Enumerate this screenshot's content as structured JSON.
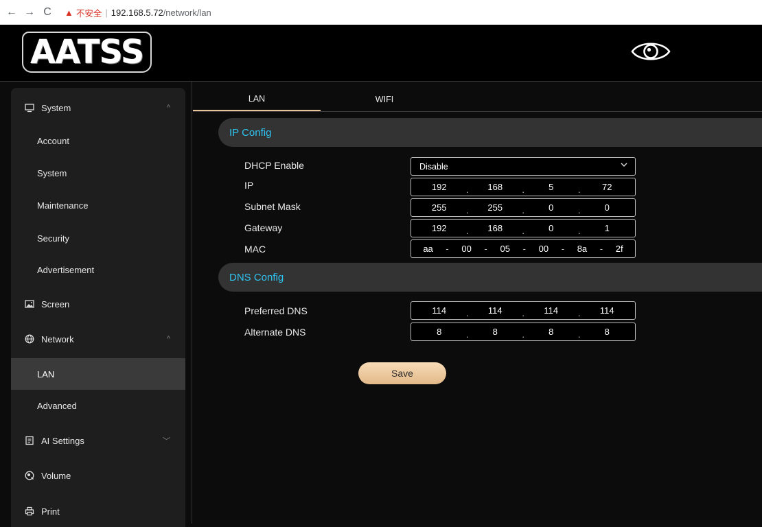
{
  "browser": {
    "back": "←",
    "forward": "→",
    "reload": "C",
    "warn": "▲",
    "insecure": "不安全",
    "sep": "|",
    "host": "192.168.5.72",
    "path": "/network/lan"
  },
  "header": {
    "logo": "AATSS"
  },
  "sidebar": {
    "system": {
      "label": "System",
      "chevron": "^"
    },
    "system_items": [
      "Account",
      "System",
      "Maintenance",
      "Security",
      "Advertisement"
    ],
    "screen": {
      "label": "Screen"
    },
    "network": {
      "label": "Network",
      "chevron": "^"
    },
    "network_items": [
      "LAN",
      "Advanced"
    ],
    "ai": {
      "label": "AI Settings",
      "chevron": "﹀"
    },
    "volume": {
      "label": "Volume"
    },
    "print": {
      "label": "Print"
    }
  },
  "tabs": {
    "lan": "LAN",
    "wifi": "WIFI"
  },
  "ip_config": {
    "title": "IP Config",
    "dhcp_label": "DHCP Enable",
    "dhcp_value": "Disable",
    "ip_label": "IP",
    "ip": [
      "192",
      "168",
      "5",
      "72"
    ],
    "mask_label": "Subnet Mask",
    "mask": [
      "255",
      "255",
      "0",
      "0"
    ],
    "gateway_label": "Gateway",
    "gateway": [
      "192",
      "168",
      "0",
      "1"
    ],
    "mac_label": "MAC",
    "mac": [
      "aa",
      "00",
      "05",
      "00",
      "8a",
      "2f"
    ]
  },
  "dns_config": {
    "title": "DNS Config",
    "preferred_label": "Preferred DNS",
    "preferred": [
      "114",
      "114",
      "114",
      "114"
    ],
    "alternate_label": "Alternate DNS",
    "alternate": [
      "8",
      "8",
      "8",
      "8"
    ]
  },
  "save_label": "Save",
  "separators": {
    "dot": ".",
    "dash": "-"
  }
}
